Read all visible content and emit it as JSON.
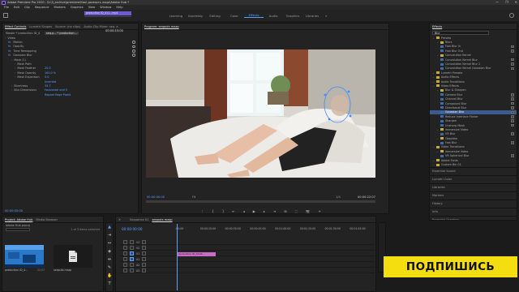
{
  "window": {
    "title": "Adobe Premiere Pro 2020 - D:\\3_archive\\premiere\\Как\\ размыть лицо\\Adobe Hub *",
    "controls": [
      "—",
      "❐",
      "✕"
    ]
  },
  "menu": [
    "File",
    "Edit",
    "Clip",
    "Sequence",
    "Markers",
    "Graphics",
    "View",
    "Window",
    "Help"
  ],
  "workspaces": {
    "tabs": [
      "Learning",
      "Assembly",
      "Editing",
      "Color",
      "Effects",
      "Audio",
      "Graphics",
      "Libraries"
    ],
    "active": "Effects",
    "more": "»"
  },
  "effect_controls": {
    "tabs": [
      "Effect Controls",
      "Lumetri Scopes",
      "Source: (no clips)",
      "Audio Clip Mixer: seq. a"
    ],
    "master": "Master * production ID_4",
    "seq": "seq.p... * production...",
    "clip_label": "production ID_411...mp4",
    "rows": [
      {
        "label": "Video",
        "indent": 0
      },
      {
        "label": "Motion",
        "indent": 1,
        "fx": true
      },
      {
        "label": "Opacity",
        "indent": 1,
        "fx": true
      },
      {
        "label": "Time Remapping",
        "indent": 1,
        "fx": true
      },
      {
        "label": "Gaussian Blur",
        "indent": 1,
        "fx": true
      },
      {
        "label": "Mask (1)",
        "indent": 2
      },
      {
        "label": "Mask Path",
        "indent": 3
      },
      {
        "label": "Mask Feather",
        "indent": 3,
        "value": "20.0"
      },
      {
        "label": "Mask Opacity",
        "indent": 3,
        "value": "100.0 %"
      },
      {
        "label": "Mask Expansion",
        "indent": 3,
        "value": "0.0"
      },
      {
        "label": "",
        "indent": 3,
        "value": "Inverted"
      },
      {
        "label": "Blurriness",
        "indent": 2,
        "value": "33.7"
      },
      {
        "label": "Blur Dimensions",
        "indent": 2,
        "value": "Horizontal and V"
      },
      {
        "label": "",
        "indent": 2,
        "value": "Repeat Edge Pixels"
      }
    ],
    "timecode_top": "00:00:15:00",
    "timecode_bottom": "00:00:00:00"
  },
  "program": {
    "tab": "Program: seqouts mazp",
    "timecode_left": "00:00:00:00",
    "fit": "Fit",
    "quality": "1/4",
    "timecode_right": "00:00:22:07",
    "controls": [
      "⋮",
      "{",
      "}",
      "⇤",
      "◂",
      "▶",
      "▸",
      "⇥",
      "⊞",
      "⬚",
      "📷",
      "+"
    ]
  },
  "effects_panel": {
    "title": "Effects",
    "search": "Blur",
    "tree": [
      {
        "label": "Presets",
        "level": 0,
        "type": "folder"
      },
      {
        "label": "Blurs",
        "level": 1,
        "type": "folder"
      },
      {
        "label": "Fast Blur In",
        "level": 2,
        "type": "effect"
      },
      {
        "label": "Fast Blur Out",
        "level": 2,
        "type": "effect"
      },
      {
        "label": "Convolution Kernel",
        "level": 1,
        "type": "folder"
      },
      {
        "label": "Convolution Kernel Blur",
        "level": 2,
        "type": "effect"
      },
      {
        "label": "Convolution Kernel Blur 2",
        "level": 2,
        "type": "effect"
      },
      {
        "label": "Convolution Kernel Gaussian Blur",
        "level": 2,
        "type": "effect"
      },
      {
        "label": "Lumetri Presets",
        "level": 0,
        "type": "folder"
      },
      {
        "label": "Audio Effects",
        "level": 0,
        "type": "folder"
      },
      {
        "label": "Audio Transitions",
        "level": 0,
        "type": "folder"
      },
      {
        "label": "Video Effects",
        "level": 0,
        "type": "folder"
      },
      {
        "label": "Blur & Sharpen",
        "level": 1,
        "type": "folder"
      },
      {
        "label": "Camera Blur",
        "level": 2,
        "type": "effect"
      },
      {
        "label": "Channel Blur",
        "level": 2,
        "type": "effect"
      },
      {
        "label": "Compound Blur",
        "level": 2,
        "type": "effect"
      },
      {
        "label": "Directional Blur",
        "level": 2,
        "type": "effect"
      },
      {
        "label": "Gaussian Blur",
        "level": 2,
        "type": "effect",
        "highlight": true
      },
      {
        "label": "Reduce Interlace Flicker",
        "level": 2,
        "type": "effect"
      },
      {
        "label": "Sharpen",
        "level": 2,
        "type": "effect"
      },
      {
        "label": "Unsharp Mask",
        "level": 2,
        "type": "effect"
      },
      {
        "label": "Immersive Video",
        "level": 1,
        "type": "folder"
      },
      {
        "label": "VR Blur",
        "level": 2,
        "type": "effect"
      },
      {
        "label": "Obsolete",
        "level": 1,
        "type": "folder"
      },
      {
        "label": "Fast Blur",
        "level": 2,
        "type": "effect"
      },
      {
        "label": "Video Transitions",
        "level": 0,
        "type": "folder"
      },
      {
        "label": "Immersive Video",
        "level": 1,
        "type": "folder"
      },
      {
        "label": "VR Spherical Blur",
        "level": 2,
        "type": "effect"
      },
      {
        "label": "Adobe Fonts",
        "level": 0,
        "type": "folder"
      },
      {
        "label": "Custom Bin 01",
        "level": 0,
        "type": "folder"
      }
    ],
    "libs": [
      "Essential Sound",
      "Lumetri Color",
      "Libraries",
      "Markers",
      "History",
      "Info",
      "Essential Graphics"
    ]
  },
  "project": {
    "tabs": [
      "Project: Adobe Hub",
      "Media Browser"
    ],
    "name": "Adobe Hub.prproj",
    "count": "1 of 3 items selected",
    "items": [
      {
        "name": "production ID_4...",
        "dur": "22:07"
      },
      {
        "name": "seqouts mazp",
        "dur": ""
      }
    ]
  },
  "timeline": {
    "tabs": [
      "Sequence 01",
      "seqouts mazp"
    ],
    "timecode": "00:00:00:00",
    "ruler": [
      ":00:00",
      "00:00:15:00",
      "00:00:30:00",
      "00:00:45:00",
      "00:01:00:00",
      "00:01:15:00",
      "00:01:30:00",
      "00:01:45:00"
    ],
    "tracks": [
      {
        "name": "V3"
      },
      {
        "name": "V2"
      },
      {
        "name": "V1",
        "clip": "production ID_4116..."
      },
      {
        "name": "A1"
      },
      {
        "name": "A2"
      },
      {
        "name": "A3"
      }
    ]
  },
  "tools": [
    "▲",
    "⇥",
    "↔",
    "◈",
    "⇹",
    "✎",
    "✋",
    "T"
  ],
  "cta": {
    "label": "ПОДПИШИСЬ",
    "bg": "#f4de10"
  }
}
